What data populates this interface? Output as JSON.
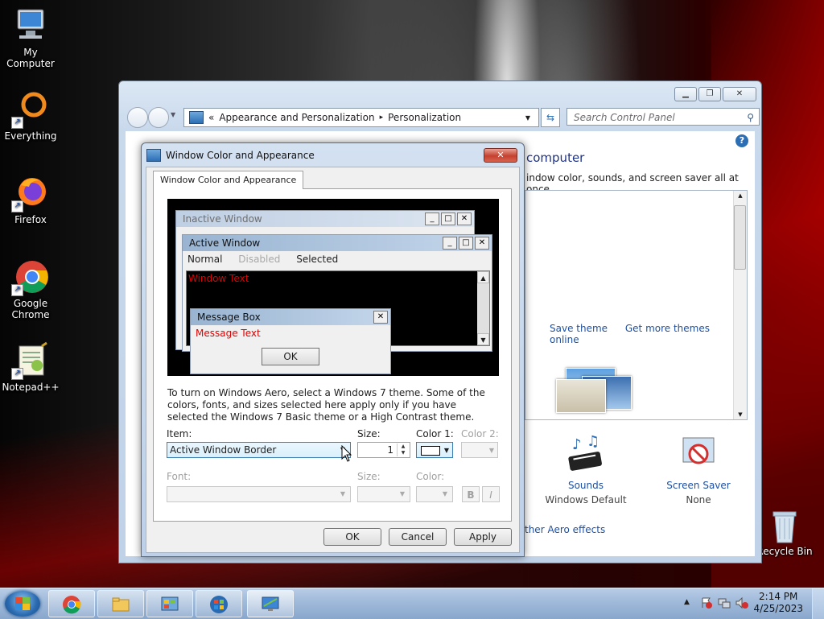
{
  "desktop": {
    "icons": [
      {
        "label": "My Computer",
        "icon": "computer-icon"
      },
      {
        "label": "Everything",
        "icon": "everything-search-icon"
      },
      {
        "label": "Firefox",
        "icon": "firefox-icon"
      },
      {
        "label": "Google Chrome",
        "icon": "chrome-icon"
      },
      {
        "label": "Notepad++",
        "icon": "notepad-plus-plus-icon"
      },
      {
        "label": "Recycle Bin",
        "icon": "recycle-bin-icon"
      }
    ]
  },
  "control_panel": {
    "address": {
      "prefix": "«",
      "crumb1": "Appearance and Personalization",
      "sep": "▸",
      "crumb2": "Personalization"
    },
    "search_placeholder": "Search Control Panel",
    "heading_partial": "computer",
    "subheading_partial": "indow color, sounds, and screen saver all at once.",
    "save_theme": "Save theme",
    "get_more_themes": "Get more themes online",
    "sounds_label": "Sounds",
    "sounds_value": "Windows Default",
    "screensaver_label": "Screen Saver",
    "screensaver_value": "None",
    "aero_partial": "ther Aero effects"
  },
  "dialog": {
    "title": "Window Color and Appearance",
    "tab": "Window Color and Appearance",
    "preview": {
      "inactive_title": "Inactive Window",
      "active_title": "Active Window",
      "menu_normal": "Normal",
      "menu_disabled": "Disabled",
      "menu_selected": "Selected",
      "window_text": "Window Text",
      "msgbox_title": "Message Box",
      "msgbox_text": "Message Text",
      "msgbox_ok": "OK"
    },
    "info": "To turn on Windows Aero, select a Windows 7 theme.  Some of the colors, fonts, and sizes selected here apply only if you have selected the Windows 7 Basic theme or a High Contrast theme.",
    "item_label": "Item:",
    "item_value": "Active Window Border",
    "size_label": "Size:",
    "size_value": "1",
    "color1_label": "Color 1:",
    "color2_label": "Color 2:",
    "font_label": "Font:",
    "font_size_label": "Size:",
    "font_color_label": "Color:",
    "bold": "B",
    "italic": "I",
    "ok": "OK",
    "cancel": "Cancel",
    "apply": "Apply"
  },
  "taskbar": {
    "time": "2:14 PM",
    "date": "4/25/2023",
    "tray_arrow": "▲"
  }
}
